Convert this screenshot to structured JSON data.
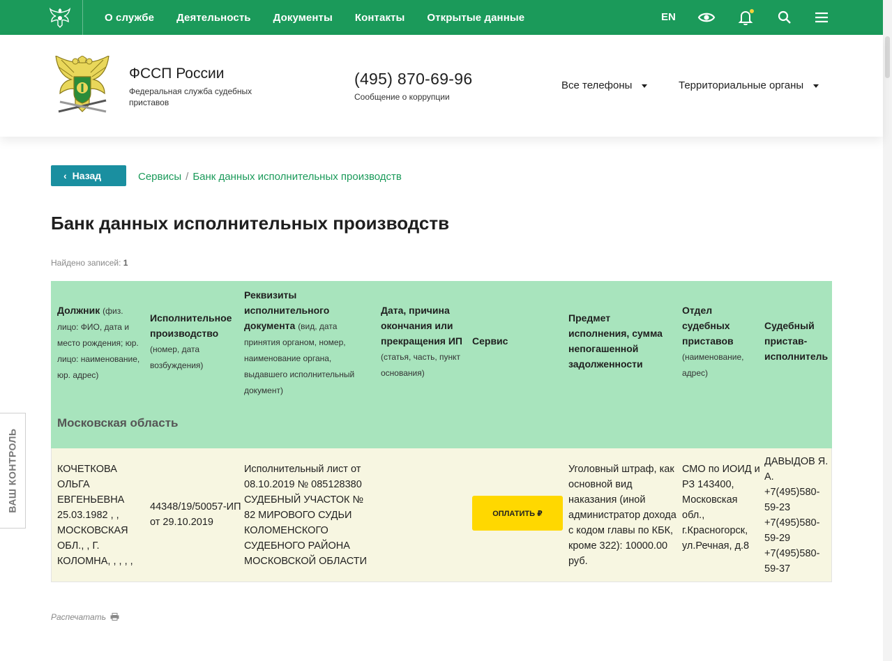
{
  "topnav": {
    "items": [
      "О службе",
      "Деятельность",
      "Документы",
      "Контакты",
      "Открытые данные"
    ],
    "lang": "EN"
  },
  "header": {
    "org_name": "ФССП России",
    "org_sub": "Федеральная служба судебных приставов",
    "phone": "(495) 870-69-96",
    "phone_sub": "Сообщение о коррупции",
    "dropdown_phones": "Все телефоны",
    "dropdown_territorial": "Территориальные органы"
  },
  "breadcrumb": {
    "back_label": "Назад",
    "items": [
      "Сервисы",
      "Банк данных исполнительных производств"
    ]
  },
  "page": {
    "title": "Банк данных исполнительных производств",
    "found_label": "Найдено записей:",
    "found_count": "1",
    "print_label": "Распечатать"
  },
  "table": {
    "headers": [
      {
        "title": "Должник",
        "note": "(физ. лицо: ФИО, дата и место рождения; юр. лицо: наименование, юр. адрес)"
      },
      {
        "title": "Исполнительное производство",
        "note": "(номер, дата возбуждения)"
      },
      {
        "title": "Реквизиты исполнительного документа",
        "note": "(вид, дата принятия органом, номер, наименование органа, выдавшего исполнительный документ)"
      },
      {
        "title": "Дата, причина окончания или прекращения ИП",
        "note": "(статья, часть, пункт основания)"
      },
      {
        "title": "Сервис",
        "note": ""
      },
      {
        "title": "Предмет исполнения, сумма непогашенной задолженности",
        "note": ""
      },
      {
        "title": "Отдел судебных приставов",
        "note": "(наименование, адрес)"
      },
      {
        "title": "Судебный пристав-исполнитель",
        "note": ""
      }
    ],
    "region": "Московская область",
    "row": {
      "debtor": "КОЧЕТКОВА ОЛЬГА ЕВГЕНЬЕВНА 25.03.1982 , , МОСКОВСКАЯ ОБЛ., , Г. КОЛОМНА, , , , ,",
      "proceeding": "44348/19/50057-ИП от 29.10.2019",
      "document": "Исполнительный лист от 08.10.2019 № 085128380 СУДЕБНЫЙ УЧАСТОК № 82 МИРОВОГО СУДЬИ КОЛОМЕНСКОГО СУДЕБНОГО РАЙОНА МОСКОВСКОЙ ОБЛАСТИ",
      "end_date": "",
      "pay_label": "ОПЛАТИТЬ ₽",
      "subject": "Уголовный штраф, как основной вид наказания (иной администратор дохода с кодом главы по КБК, кроме 322): 10000.00 руб.",
      "department": "СМО по ИОИД и РЗ 143400, Московская обл., г.Красногорск, ул.Речная, д.8",
      "bailiff": "ДАВЫДОВ Я. А. +7(495)580-59-23 +7(495)580-59-29 +7(495)580-59-37"
    }
  },
  "side_tab": "ВАШ КОНТРОЛЬ",
  "colors": {
    "top_green": "#1b9a5a",
    "link_green": "#1b9a5a",
    "back_button": "#1a8fa0",
    "table_header": "#a8e4bd",
    "table_row": "#f7f6e1",
    "pay_button": "#ffd800"
  },
  "icons": [
    "emblem-icon",
    "eye-icon",
    "bell-icon",
    "search-icon",
    "menu-icon",
    "printer-icon"
  ]
}
